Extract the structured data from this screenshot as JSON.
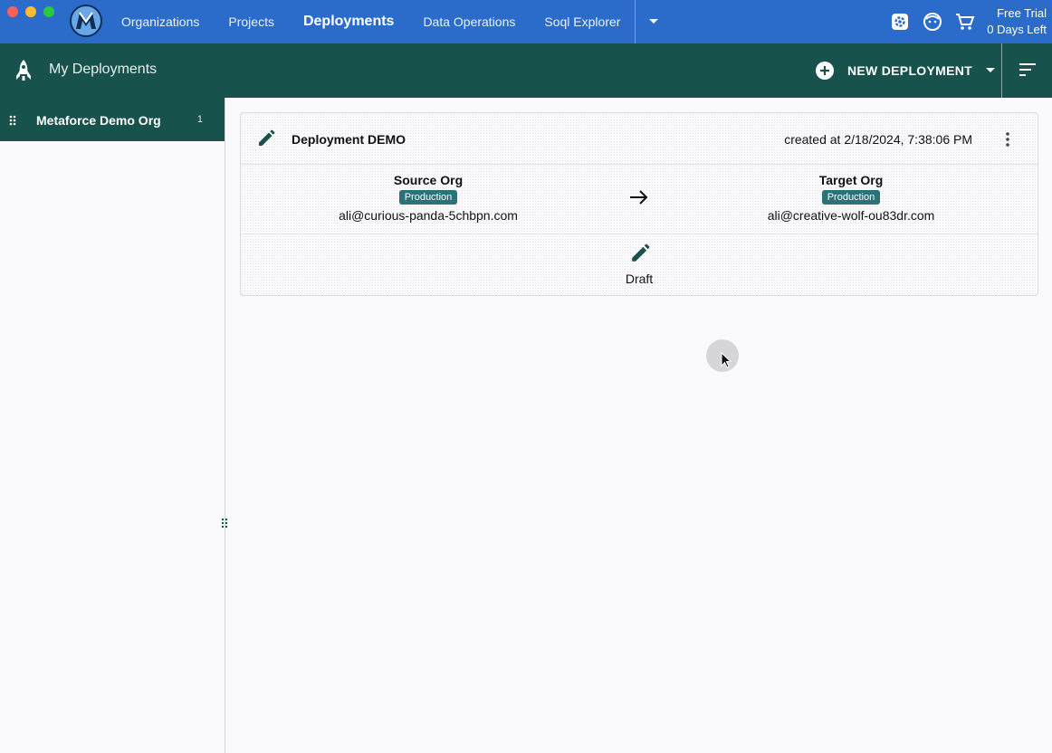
{
  "window": {
    "traffic_colors": [
      "#fe5f57",
      "#febc2e",
      "#28c840"
    ]
  },
  "nav": {
    "items": [
      {
        "label": "Organizations",
        "active": false
      },
      {
        "label": "Projects",
        "active": false
      },
      {
        "label": "Deployments",
        "active": true
      },
      {
        "label": "Data Operations",
        "active": false
      },
      {
        "label": "Soql Explorer",
        "active": false
      }
    ],
    "more_icon": "caret-down-icon",
    "right_icons": [
      "settings-icon",
      "account-icon",
      "cart-icon"
    ],
    "trial_line1": "Free Trial",
    "trial_line2": "0 Days Left"
  },
  "header": {
    "icon": "rocket-icon",
    "title": "My Deployments",
    "new_button_label": "NEW DEPLOYMENT",
    "sort_icon": "sort-icon"
  },
  "sidebar": {
    "items": [
      {
        "label": "Metaforce Demo Org",
        "count": "1"
      }
    ]
  },
  "deployment": {
    "title": "Deployment DEMO",
    "created": "created at 2/18/2024, 7:38:06 PM",
    "source": {
      "heading": "Source Org",
      "badge": "Production",
      "email": "ali@curious-panda-5chbpn.com"
    },
    "target": {
      "heading": "Target Org",
      "badge": "Production",
      "email": "ali@creative-wolf-ou83dr.com"
    },
    "status": "Draft"
  },
  "colors": {
    "topbar": "#2b6ccb",
    "subbar": "#17524c",
    "badge": "#2a7278",
    "accent": "#17524c"
  }
}
